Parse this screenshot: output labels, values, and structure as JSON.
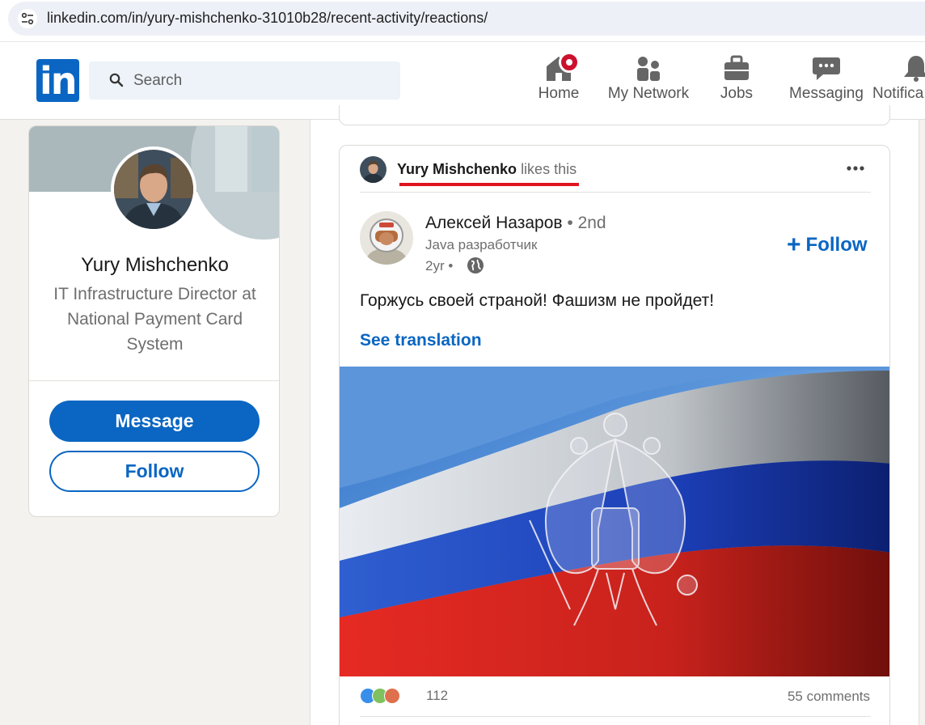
{
  "browser": {
    "url": "linkedin.com/in/yury-mishchenko-31010b28/recent-activity/reactions/"
  },
  "header": {
    "logo_text": "in",
    "search_placeholder": "Search",
    "nav": [
      {
        "label": "Home",
        "icon": "home-icon",
        "has_badge": true
      },
      {
        "label": "My Network",
        "icon": "network-icon"
      },
      {
        "label": "Jobs",
        "icon": "briefcase-icon"
      },
      {
        "label": "Messaging",
        "icon": "messaging-icon"
      },
      {
        "label": "Notifica",
        "icon": "bell-icon"
      }
    ]
  },
  "profile_card": {
    "name": "Yury Mishchenko",
    "headline": "IT Infrastructure Director at National Payment Card System",
    "message_label": "Message",
    "follow_label": "Follow"
  },
  "post": {
    "context": {
      "name": "Yury Mishchenko",
      "action": "likes this"
    },
    "author": {
      "name": "Алексей Назаров",
      "degree": "• 2nd",
      "title": "Java разработчик",
      "time": "2yr •"
    },
    "follow_label": "Follow",
    "text": "Горжусь своей страной! Фашизм не пройдет!",
    "see_translation": "See translation",
    "image_alt": "Russian flag with double-headed eagle coat of arms",
    "reaction_count": "112",
    "comments": "55 comments"
  },
  "colors": {
    "brand": "#0a66c2",
    "highlight": "#e0141e",
    "badge": "#cb112d"
  }
}
